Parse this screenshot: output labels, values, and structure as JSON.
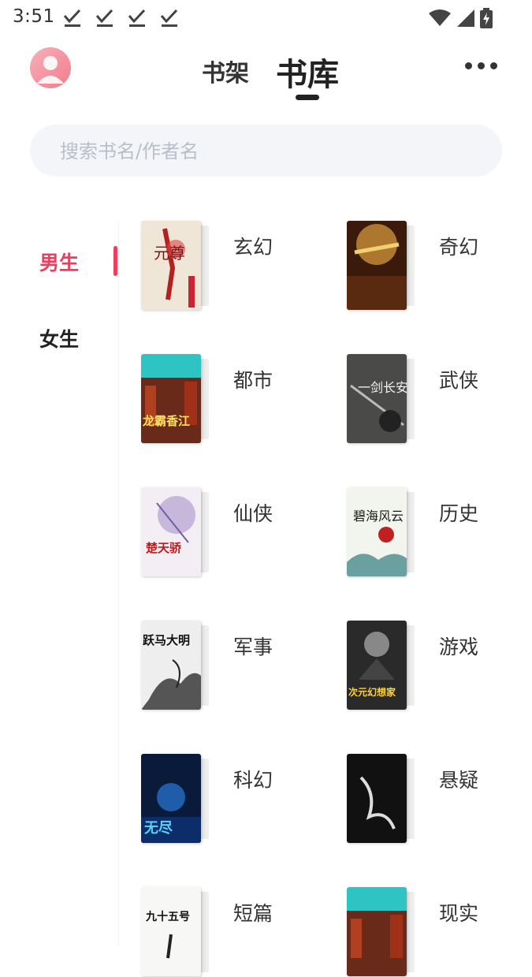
{
  "status_bar": {
    "time": "3:51",
    "notification_icons": [
      "check-icon",
      "check-icon",
      "check-icon",
      "check-icon"
    ],
    "right_icons": [
      "wifi-icon",
      "signal-icon",
      "battery-charging-icon"
    ]
  },
  "header": {
    "avatar_icon": "user-avatar-icon",
    "tabs": [
      {
        "label": "书架",
        "active": false
      },
      {
        "label": "书库",
        "active": true
      }
    ],
    "more_icon": "more-dots-icon"
  },
  "search": {
    "placeholder": "搜索书名/作者名",
    "value": ""
  },
  "sidebar": {
    "items": [
      {
        "label": "男生",
        "active": true
      },
      {
        "label": "女生",
        "active": false
      }
    ],
    "accent_color": "#ee3e60"
  },
  "categories": [
    {
      "label": "玄幻",
      "cover_text": "元尊"
    },
    {
      "label": "奇幻",
      "cover_text": ""
    },
    {
      "label": "都市",
      "cover_text": "龙霸香江"
    },
    {
      "label": "武侠",
      "cover_text": "一剑长安"
    },
    {
      "label": "仙侠",
      "cover_text": "楚天骄"
    },
    {
      "label": "历史",
      "cover_text": "碧海风云"
    },
    {
      "label": "军事",
      "cover_text": "跃马大明"
    },
    {
      "label": "游戏",
      "cover_text": "次元幻想家"
    },
    {
      "label": "科幻",
      "cover_text": "无尽"
    },
    {
      "label": "悬疑",
      "cover_text": ""
    },
    {
      "label": "短篇",
      "cover_text": "九十五号"
    },
    {
      "label": "现实",
      "cover_text": ""
    }
  ]
}
